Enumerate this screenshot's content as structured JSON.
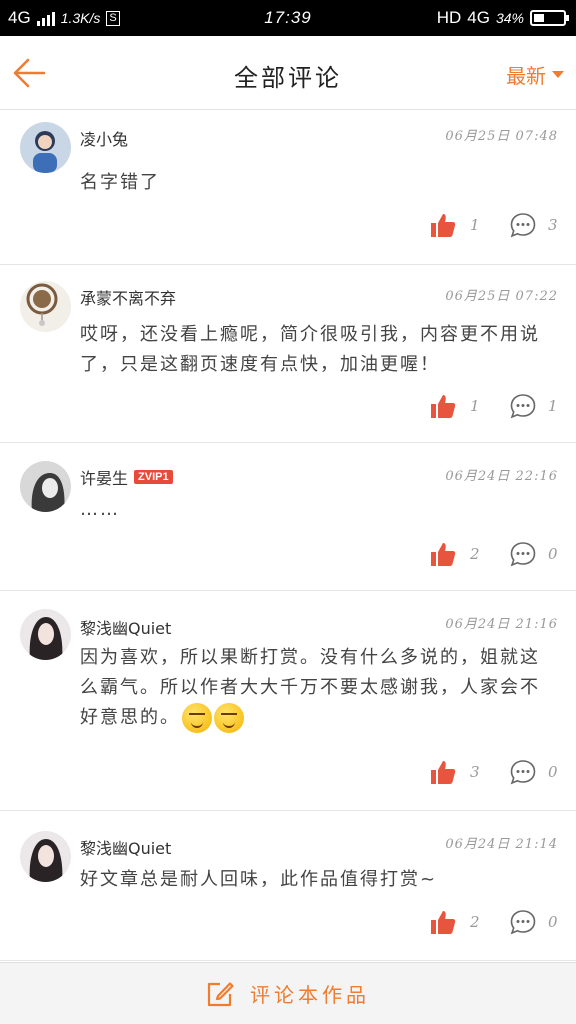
{
  "status_bar": {
    "network_left": "4G",
    "speed": "1.3K/s",
    "sim_label": "S",
    "time": "17:39",
    "hd": "HD",
    "network_right": "4G",
    "battery": "34%",
    "battery_level": 0.34
  },
  "header": {
    "title": "全部评论",
    "sort_label": "最新"
  },
  "comments": [
    {
      "user": "凌小兔",
      "vip": "",
      "time": "06月25日 07:48",
      "text": "名字错了",
      "likes": "1",
      "replies": "3"
    },
    {
      "user": "承蒙不离不弃",
      "vip": "",
      "time": "06月25日 07:22",
      "text": "哎呀，还没看上瘾呢，简介很吸引我，内容更不用说了，只是这翻页速度有点快，加油更喔！",
      "likes": "1",
      "replies": "1"
    },
    {
      "user": "许晏生",
      "vip": "ZVIP1",
      "time": "06月24日 22:16",
      "text": "……",
      "likes": "2",
      "replies": "0"
    },
    {
      "user": "黎浅幽Quiet",
      "vip": "",
      "time": "06月24日 21:16",
      "text": "因为喜欢，所以果断打赏。没有什么多说的，姐就这么霸气。所以作者大大千万不要太感谢我，人家会不好意思的。",
      "likes": "3",
      "replies": "0"
    },
    {
      "user": "黎浅幽Quiet",
      "vip": "",
      "time": "06月24日 21:14",
      "text": "好文章总是耐人回味，此作品值得打赏~",
      "likes": "2",
      "replies": "0"
    }
  ],
  "footer": {
    "label": "评论本作品"
  },
  "colors": {
    "accent": "#ef7c2f",
    "like_red": "#e8553e",
    "vip_red": "#e84a3a"
  },
  "icons": [
    "back-arrow-icon",
    "chevron-down-icon",
    "thumbs-up-icon",
    "comment-bubble-icon",
    "edit-icon",
    "smirk-emoji-icon",
    "signal-icon",
    "battery-icon"
  ]
}
